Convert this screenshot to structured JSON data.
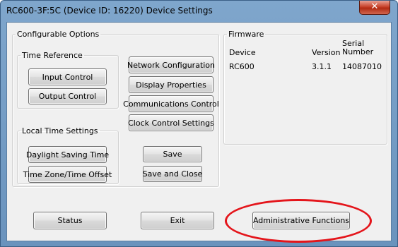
{
  "window": {
    "title": "RC600-3F:5C (Device ID: 16220) Device Settings",
    "close_label": "✕"
  },
  "configurable": {
    "legend": "Configurable Options",
    "time_reference": {
      "legend": "Time Reference",
      "input_control": "Input Control",
      "output_control": "Output Control"
    },
    "local_time": {
      "legend": "Local Time Settings",
      "daylight_saving": "Daylight Saving Time",
      "time_zone": "Time Zone/Time Offset"
    },
    "buttons": {
      "network_configuration": "Network Configuration",
      "display_properties": "Display Properties",
      "communications_control": "Communications Control",
      "clock_control_settings": "Clock Control Settings",
      "save": "Save",
      "save_and_close": "Save and Close"
    }
  },
  "firmware": {
    "legend": "Firmware",
    "headers": {
      "device": "Device",
      "version": "Version",
      "serial_line1": "Serial",
      "serial_line2": "Number"
    },
    "row": {
      "device": "RC600",
      "version": "3.1.1",
      "serial": "14087010"
    }
  },
  "bottom": {
    "status": "Status",
    "exit": "Exit",
    "administrative": "Administrative Functions"
  },
  "annotation": {
    "highlight_color": "#e4151b"
  }
}
